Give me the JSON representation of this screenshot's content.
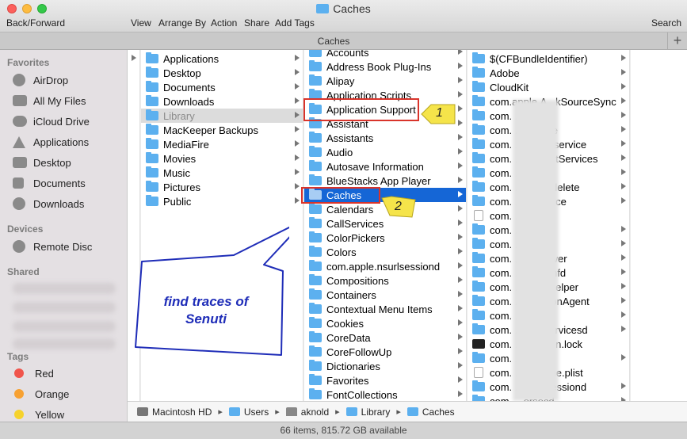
{
  "window": {
    "title": "Caches"
  },
  "toolbar": {
    "back_forward": "Back/Forward",
    "view": "View",
    "arrange_by": "Arrange By",
    "action": "Action",
    "share": "Share",
    "add_tags": "Add Tags",
    "search": "Search"
  },
  "tabbar": {
    "label": "Caches",
    "add": "+"
  },
  "sidebar": {
    "favorites_header": "Favorites",
    "favorites": [
      {
        "label": "AirDrop",
        "icon": "airdrop-icon"
      },
      {
        "label": "All My Files",
        "icon": "all-files-icon"
      },
      {
        "label": "iCloud Drive",
        "icon": "cloud-icon"
      },
      {
        "label": "Applications",
        "icon": "applications-icon"
      },
      {
        "label": "Desktop",
        "icon": "desktop-icon"
      },
      {
        "label": "Documents",
        "icon": "documents-icon"
      },
      {
        "label": "Downloads",
        "icon": "downloads-icon"
      }
    ],
    "devices_header": "Devices",
    "devices": [
      {
        "label": "Remote Disc",
        "icon": "disc-icon"
      }
    ],
    "shared_header": "Shared",
    "tags_header": "Tags",
    "tags": [
      {
        "label": "Red",
        "color": "#f0544b"
      },
      {
        "label": "Orange",
        "color": "#f7a132"
      },
      {
        "label": "Yellow",
        "color": "#f6d22c"
      }
    ]
  },
  "column1": {
    "items": [
      {
        "label": "Applications",
        "icon": "folder-icon"
      },
      {
        "label": "Desktop",
        "icon": "folder-icon"
      },
      {
        "label": "Documents",
        "icon": "folder-icon"
      },
      {
        "label": "Downloads",
        "icon": "folder-icon"
      },
      {
        "label": "Library",
        "icon": "folder-icon",
        "state": "highlighted"
      },
      {
        "label": "MacKeeper Backups",
        "icon": "folder-icon"
      },
      {
        "label": "MediaFire",
        "icon": "folder-icon"
      },
      {
        "label": "Movies",
        "icon": "folder-icon"
      },
      {
        "label": "Music",
        "icon": "folder-icon"
      },
      {
        "label": "Pictures",
        "icon": "folder-icon"
      },
      {
        "label": "Public",
        "icon": "folder-icon"
      }
    ]
  },
  "column2": {
    "items": [
      {
        "label": "Accounts"
      },
      {
        "label": "Address Book Plug-Ins"
      },
      {
        "label": "Alipay"
      },
      {
        "label": "Application Scripts"
      },
      {
        "label": "Application Support"
      },
      {
        "label": "Assistant"
      },
      {
        "label": "Assistants"
      },
      {
        "label": "Audio"
      },
      {
        "label": "Autosave Information"
      },
      {
        "label": "BlueStacks App Player"
      },
      {
        "label": "Caches",
        "state": "selected"
      },
      {
        "label": "Calendars"
      },
      {
        "label": "CallServices"
      },
      {
        "label": "ColorPickers"
      },
      {
        "label": "Colors"
      },
      {
        "label": "com.apple.nsurlsessiond"
      },
      {
        "label": "Compositions"
      },
      {
        "label": "Containers"
      },
      {
        "label": "Contextual Menu Items"
      },
      {
        "label": "Cookies"
      },
      {
        "label": "CoreData"
      },
      {
        "label": "CoreFollowUp"
      },
      {
        "label": "Dictionaries"
      },
      {
        "label": "Favorites"
      },
      {
        "label": "FontCollections"
      }
    ]
  },
  "column3": {
    "items": [
      {
        "label": "$(CFBundleIdentifier)",
        "icon": "folder"
      },
      {
        "label": "Adobe",
        "icon": "folder"
      },
      {
        "label": "CloudKit",
        "icon": "folder"
      },
      {
        "label": "com.apple.A...kSourceSync",
        "icon": "folder"
      },
      {
        "label": "com.          ...kd",
        "icon": "folder"
      },
      {
        "label": "com.          ...ppstore",
        "icon": "folder"
      },
      {
        "label": "com.          ...istant_service",
        "icon": "folder"
      },
      {
        "label": "com.          ...ssistantServices",
        "icon": "folder"
      },
      {
        "label": "com.          ...rd",
        "icon": "folder"
      },
      {
        "label": "com.          ...ache_delete",
        "icon": "folder"
      },
      {
        "label": "com.          ...ommerce",
        "icon": "folder"
      },
      {
        "label": "com.          ...Xcode",
        "icon": "doc"
      },
      {
        "label": "com.          ...nder",
        "icon": "folder"
      },
      {
        "label": "com.          ...elpd",
        "icon": "folder"
      },
      {
        "label": "com.          ...elpviewer",
        "icon": "folder"
      },
      {
        "label": "com.          ...loud.fmfd",
        "icon": "folder"
      },
      {
        "label": "com.          ...cloudHelper",
        "icon": "folder"
      },
      {
        "label": "com.          ...nnectionAgent",
        "icon": "folder"
      },
      {
        "label": "com.          ...staller",
        "icon": "folder"
      },
      {
        "label": "com.          ...oardservicesd",
        "icon": "folder"
      },
      {
        "label": "com.          ...oreopen.lock",
        "icon": "term"
      },
      {
        "label": "com.          ...bagent",
        "icon": "folder"
      },
      {
        "label": "com.          ...escache.plist",
        "icon": "doc"
      },
      {
        "label": "com.          ...nsurlsessiond",
        "icon": "folder"
      },
      {
        "label": "com.          ...ersecd",
        "icon": "folder"
      }
    ]
  },
  "pathbar": {
    "items": [
      "Macintosh HD",
      "Users",
      "aknold",
      "Library",
      "Caches"
    ]
  },
  "status": {
    "text": "66 items, 815.72 GB available"
  },
  "annotations": {
    "badge1": "1",
    "badge2": "2",
    "callout_line1": "find traces of",
    "callout_line2": "Senuti"
  }
}
